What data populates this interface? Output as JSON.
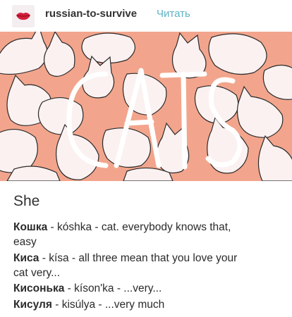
{
  "header": {
    "blog_name": "russian-to-survive",
    "follow_label": "Читать",
    "avatar_icon": "lips-logo-icon"
  },
  "cover": {
    "lettering": "CATS",
    "background_color": "#f2a58c",
    "line_color": "#2a2a2a",
    "cat_fill": "#fbf1f1"
  },
  "post": {
    "title": "She",
    "lines": [
      {
        "word": "Кошка",
        "rest": " - kóshka - cat. everybody knows that,"
      },
      {
        "word": "",
        "rest": "easy"
      },
      {
        "word": "Киса",
        "rest": " - kísa - all three mean that you love your"
      },
      {
        "word": "",
        "rest": "cat very..."
      },
      {
        "word": "Кисонька",
        "rest": " - kíson'ka - ...very..."
      },
      {
        "word": "Кисуля",
        "rest": " - kisúlya - ...very much"
      }
    ]
  }
}
